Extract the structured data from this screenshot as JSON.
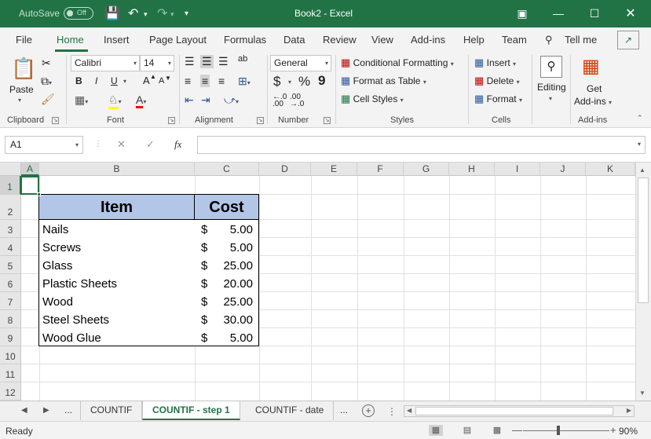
{
  "titlebar": {
    "autosave_label": "AutoSave",
    "autosave_state": "Off",
    "title": "Book2  -  Excel"
  },
  "ribbon_tabs": [
    "File",
    "Home",
    "Insert",
    "Page Layout",
    "Formulas",
    "Data",
    "Review",
    "View",
    "Add-ins",
    "Help",
    "Team"
  ],
  "active_tab": "Home",
  "tell_me": "Tell me",
  "clipboard": {
    "paste": "Paste",
    "label": "Clipboard"
  },
  "font": {
    "name": "Calibri",
    "size": "14",
    "bold": "B",
    "italic": "I",
    "underline": "U",
    "grow": "A",
    "shrink": "A",
    "color_letter": "A",
    "label": "Font"
  },
  "alignment": {
    "label": "Alignment",
    "wrap_glyph": "ab"
  },
  "number": {
    "format": "General",
    "currency": "$",
    "percent": "%",
    "comma": "9",
    "inc_dec": ".0\n.00",
    "label": "Number"
  },
  "styles": {
    "conditional": "Conditional Formatting",
    "format_table": "Format as Table",
    "cell_styles": "Cell Styles",
    "label": "Styles"
  },
  "cells": {
    "insert": "Insert",
    "delete": "Delete",
    "format": "Format",
    "label": "Cells"
  },
  "editing": {
    "label": "Editing"
  },
  "addins": {
    "get": "Get",
    "addins": "Add-ins",
    "label": "Add-ins"
  },
  "formula_bar": {
    "name_box": "A1",
    "fx": "fx",
    "value": ""
  },
  "columns": [
    "A",
    "B",
    "C",
    "D",
    "E",
    "F",
    "G",
    "H",
    "I",
    "J",
    "K"
  ],
  "rows": [
    "1",
    "2",
    "3",
    "4",
    "5",
    "6",
    "7",
    "8",
    "9",
    "10",
    "11",
    "12"
  ],
  "table": {
    "header_item": "Item",
    "header_cost": "Cost",
    "currency": "$",
    "rows": [
      {
        "item": "Nails",
        "cost": "5.00"
      },
      {
        "item": "Screws",
        "cost": "5.00"
      },
      {
        "item": "Glass",
        "cost": "25.00"
      },
      {
        "item": "Plastic Sheets",
        "cost": "20.00"
      },
      {
        "item": "Wood",
        "cost": "25.00"
      },
      {
        "item": "Steel Sheets",
        "cost": "30.00"
      },
      {
        "item": "Wood Glue",
        "cost": "5.00"
      }
    ]
  },
  "sheets": [
    "...",
    "COUNTIF",
    "COUNTIF - step 1",
    "COUNTIF - date",
    "..."
  ],
  "active_sheet": "COUNTIF - step 1",
  "status": {
    "ready": "Ready",
    "zoom": "90%"
  },
  "colors": {
    "excel_green": "#217346",
    "header_fill": "#b4c6e7"
  }
}
